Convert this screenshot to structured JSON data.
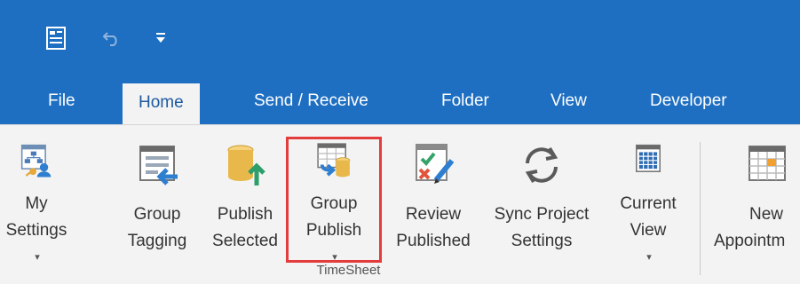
{
  "tabs": [
    {
      "label": "File"
    },
    {
      "label": "Home"
    },
    {
      "label": "Send / Receive"
    },
    {
      "label": "Folder"
    },
    {
      "label": "View"
    },
    {
      "label": "Developer"
    }
  ],
  "ribbon": {
    "group_label": "TimeSheet",
    "buttons": [
      {
        "line1": "My",
        "line2": "Settings",
        "icon": "my-settings-icon"
      },
      {
        "line1": "Group",
        "line2": "Tagging",
        "icon": "group-tagging-icon"
      },
      {
        "line1": "Publish",
        "line2": "Selected",
        "icon": "publish-selected-icon"
      },
      {
        "line1": "Group",
        "line2": "Publish",
        "icon": "group-publish-icon"
      },
      {
        "line1": "Review",
        "line2": "Published",
        "icon": "review-published-icon"
      },
      {
        "line1": "Sync Project",
        "line2": "Settings",
        "icon": "sync-icon"
      },
      {
        "line1": "Current",
        "line2": "View",
        "icon": "current-view-icon"
      },
      {
        "line1": "New",
        "line2": "Appointm",
        "icon": "new-appointment-icon"
      }
    ]
  },
  "colors": {
    "ribbon_blue": "#1e6fc2",
    "highlight": "#e23c3c"
  }
}
